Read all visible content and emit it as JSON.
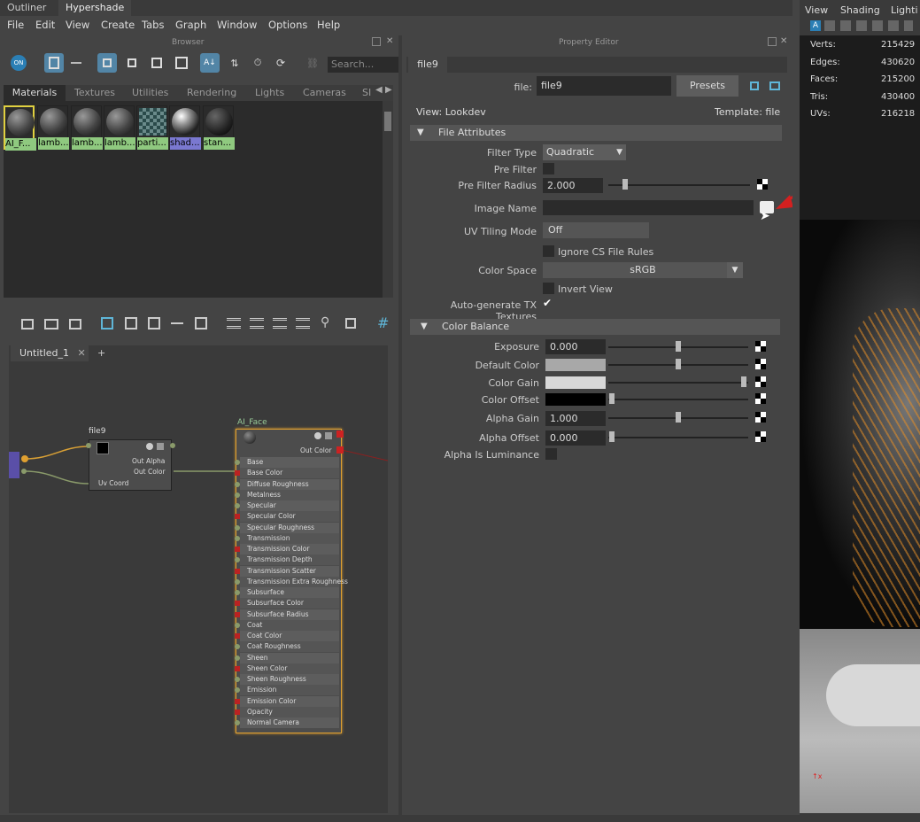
{
  "top_tabs": [
    "Outliner",
    "Hypershade"
  ],
  "menu": [
    "File",
    "Edit",
    "View",
    "Create",
    "Tabs",
    "Graph",
    "Window",
    "Options",
    "Help"
  ],
  "browser": {
    "title": "Browser",
    "search_placeholder": "Search...",
    "category_tabs": [
      "Materials",
      "Textures",
      "Utilities",
      "Rendering",
      "Lights",
      "Cameras",
      "SI"
    ],
    "swatches": [
      {
        "label": "AI_F...",
        "color": "#8fc97f"
      },
      {
        "label": "lamb...",
        "color": "#8fc97f"
      },
      {
        "label": "lamb...",
        "color": "#8fc97f"
      },
      {
        "label": "lamb...",
        "color": "#8fc97f"
      },
      {
        "label": "parti...",
        "color": "#8fc97f"
      },
      {
        "label": "shad...",
        "color": "#7a78d0"
      },
      {
        "label": "stan...",
        "color": "#8fc97f"
      }
    ]
  },
  "graph": {
    "tab_label": "Untitled_1",
    "new_tab": "+",
    "file_node": {
      "title": "file9",
      "rows": [
        "Out Alpha",
        "Out Color",
        "Uv Coord"
      ]
    },
    "ai_node": {
      "title": "AI_Face",
      "out": "Out Color",
      "rows": [
        "Base",
        "Base Color",
        "Diffuse Roughness",
        "Metalness",
        "Specular",
        "Specular Color",
        "Specular Roughness",
        "Transmission",
        "Transmission Color",
        "Transmission Depth",
        "Transmission Scatter",
        "Transmission Extra Roughness",
        "Subsurface",
        "Subsurface Color",
        "Subsurface Radius",
        "Coat",
        "Coat Color",
        "Coat Roughness",
        "Sheen",
        "Sheen Color",
        "Sheen Roughness",
        "Emission",
        "Emission Color",
        "Opacity",
        "Normal Camera"
      ]
    }
  },
  "property_editor": {
    "title": "Property Editor",
    "tab": "file9",
    "file_label": "file:",
    "file_value": "file9",
    "presets": "Presets",
    "view": "View: Lookdev",
    "template": "Template: file",
    "file_attributes": "File Attributes",
    "filter_type_label": "Filter Type",
    "filter_type_value": "Quadratic",
    "pre_filter_label": "Pre Filter",
    "pre_filter_radius_label": "Pre Filter Radius",
    "pre_filter_radius_value": "2.000",
    "image_name_label": "Image Name",
    "uv_tiling_label": "UV Tiling Mode",
    "uv_tiling_value": "Off",
    "ignore_cs": "Ignore CS File Rules",
    "color_space_label": "Color Space",
    "color_space_value": "sRGB",
    "invert_view": "Invert View",
    "auto_tx": "Auto-generate TX Textures",
    "color_balance": "Color Balance",
    "exposure_label": "Exposure",
    "exposure_value": "0.000",
    "default_color_label": "Default Color",
    "color_gain_label": "Color Gain",
    "color_offset_label": "Color Offset",
    "alpha_gain_label": "Alpha Gain",
    "alpha_gain_value": "1.000",
    "alpha_offset_label": "Alpha Offset",
    "alpha_offset_value": "0.000",
    "alpha_lum_label": "Alpha Is Luminance"
  },
  "viewport": {
    "menu": [
      "View",
      "Shading",
      "Lighti"
    ],
    "stats": [
      {
        "label": "Verts:",
        "value": "215429"
      },
      {
        "label": "Edges:",
        "value": "430620"
      },
      {
        "label": "Faces:",
        "value": "215200"
      },
      {
        "label": "Tris:",
        "value": "430400"
      },
      {
        "label": "UVs:",
        "value": "216218"
      }
    ]
  }
}
